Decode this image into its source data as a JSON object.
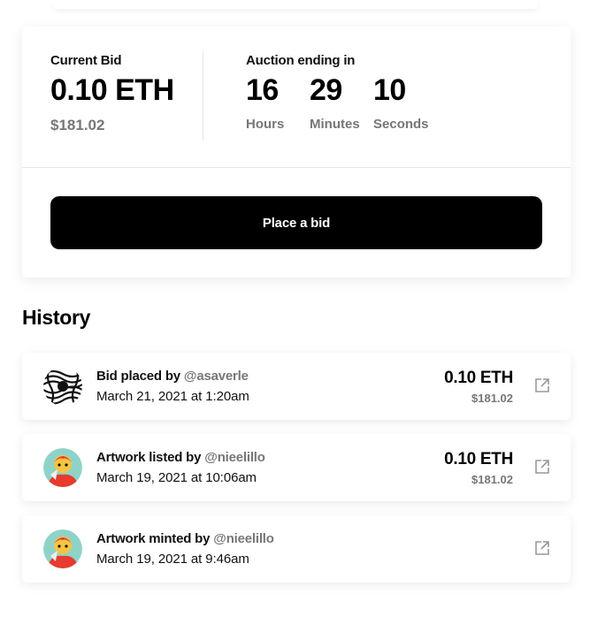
{
  "auction": {
    "current_bid_label": "Current Bid",
    "current_bid_eth": "0.10 ETH",
    "current_bid_usd": "$181.02",
    "ending_label": "Auction ending in",
    "hours": "16",
    "hours_label": "Hours",
    "minutes": "29",
    "minutes_label": "Minutes",
    "seconds": "10",
    "seconds_label": "Seconds",
    "place_bid_label": "Place a bid"
  },
  "history": {
    "title": "History",
    "items": [
      {
        "action": "Bid placed by",
        "user": "@asaverle",
        "date": "March 21, 2021 at 1:20am",
        "amount_eth": "0.10 ETH",
        "amount_usd": "$181.02",
        "avatar": "op-art-avatar"
      },
      {
        "action": "Artwork listed by",
        "user": "@nieelillo",
        "date": "March 19, 2021 at 10:06am",
        "amount_eth": "0.10 ETH",
        "amount_usd": "$181.02",
        "avatar": "illustrated-avatar"
      },
      {
        "action": "Artwork minted by",
        "user": "@nieelillo",
        "date": "March 19, 2021 at 9:46am",
        "amount_eth": "",
        "amount_usd": "",
        "avatar": "illustrated-avatar"
      }
    ]
  },
  "colors": {
    "button_bg": "#000000",
    "muted_text": "#777777"
  },
  "icons": {
    "external_link": "external-link-icon"
  }
}
